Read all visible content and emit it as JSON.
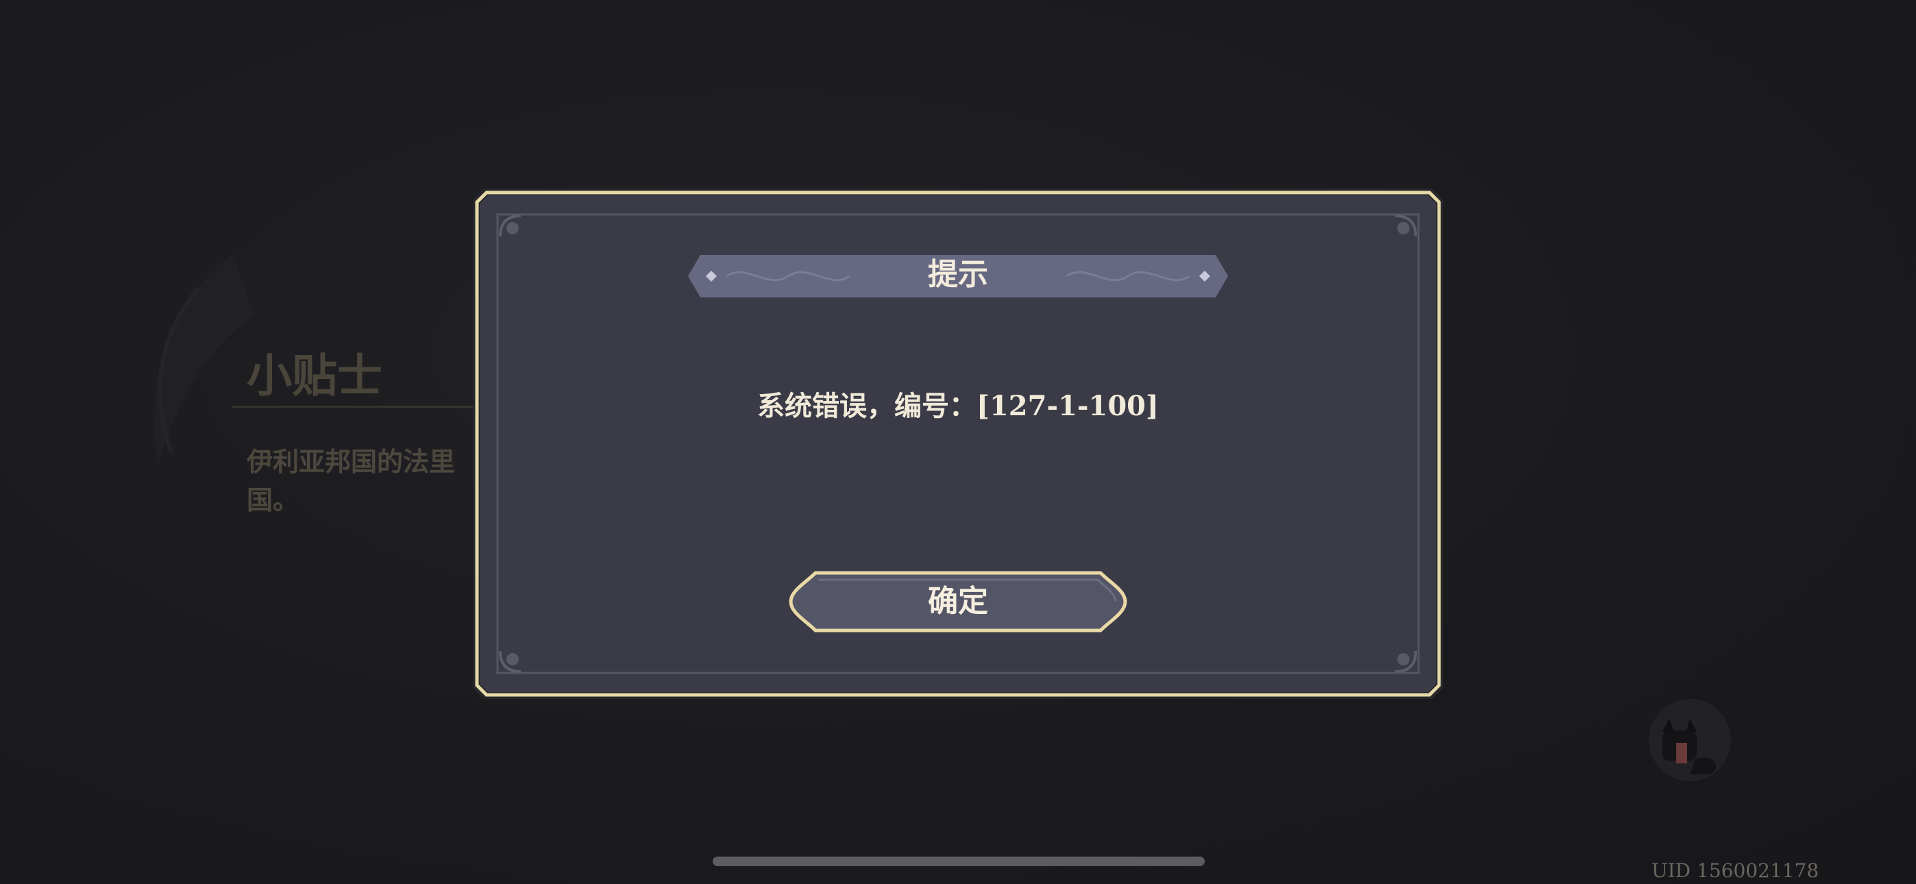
{
  "background": {
    "tip_title": "小贴士",
    "tip_body": "伊利亚邦国的法里国。",
    "uid": "UID 1560021178",
    "mascot_icon": "cat-mascot-icon"
  },
  "dialog": {
    "title": "提示",
    "message": "系统错误，编号：[127-1-100]",
    "confirm_label": "确定"
  },
  "colors": {
    "frame_gold": "#e6d9a8",
    "panel": "#3a3b47",
    "title_banner": "#6a6c86",
    "button_fill": "#545667"
  }
}
